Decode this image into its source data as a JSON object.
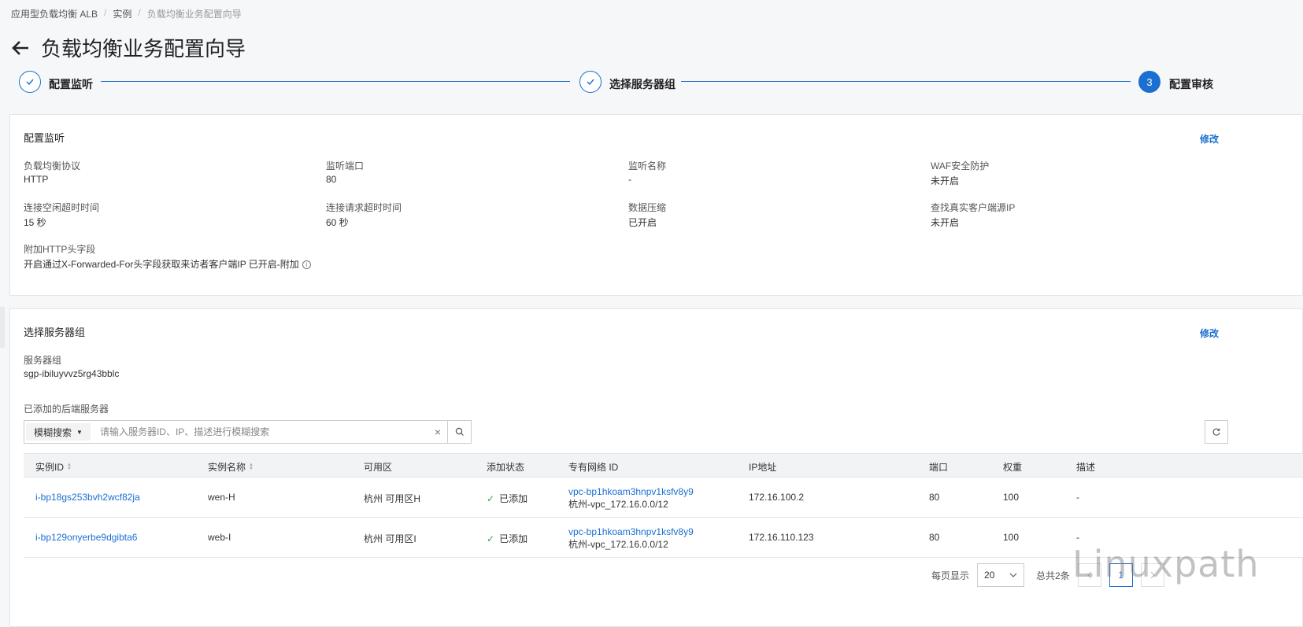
{
  "breadcrumb": [
    "应用型负载均衡 ALB",
    "实例",
    "负载均衡业务配置向导"
  ],
  "page_title": "负载均衡业务配置向导",
  "steps": [
    {
      "label": "配置监听",
      "state": "done"
    },
    {
      "label": "选择服务器组",
      "state": "done"
    },
    {
      "label": "配置审核",
      "state": "current",
      "number": "3"
    }
  ],
  "listen": {
    "title": "配置监听",
    "edit": "修改",
    "fields": [
      {
        "label": "负载均衡协议",
        "value": "HTTP"
      },
      {
        "label": "监听端口",
        "value": "80"
      },
      {
        "label": "监听名称",
        "value": "-"
      },
      {
        "label": "WAF安全防护",
        "value": "未开启"
      },
      {
        "label": "连接空闲超时时间",
        "value": "15 秒"
      },
      {
        "label": "连接请求超时时间",
        "value": "60 秒"
      },
      {
        "label": "数据压缩",
        "value": "已开启"
      },
      {
        "label": "查找真实客户端源IP",
        "value": "未开启"
      },
      {
        "label": "附加HTTP头字段",
        "value": "开启通过X-Forwarded-For头字段获取来访者客户端IP 已开启-附加"
      }
    ],
    "info_icon": "i"
  },
  "server_group": {
    "title": "选择服务器组",
    "edit": "修改",
    "group_label": "服务器组",
    "group_value": "sgp-ibiluyvvz5rg43bblc",
    "added_label": "已添加的后端服务器",
    "search": {
      "type": "模糊搜索",
      "placeholder": "请输入服务器ID、IP、描述进行模糊搜索"
    },
    "columns": [
      "实例ID",
      "实例名称",
      "可用区",
      "添加状态",
      "专有网络 ID",
      "IP地址",
      "端口",
      "权重",
      "描述"
    ],
    "rows": [
      {
        "id": "i-bp18gs253bvh2wcf82ja",
        "name": "wen-H",
        "zone": "杭州 可用区H",
        "status": "已添加",
        "vpc_id": "vpc-bp1hkoam3hnpv1ksfv8y9",
        "vpc_name": "杭州-vpc_172.16.0.0/12",
        "ip": "172.16.100.2",
        "port": "80",
        "weight": "100",
        "desc": "-"
      },
      {
        "id": "i-bp129onyerbe9dgibta6",
        "name": "web-I",
        "zone": "杭州 可用区I",
        "status": "已添加",
        "vpc_id": "vpc-bp1hkoam3hnpv1ksfv8y9",
        "vpc_name": "杭州-vpc_172.16.0.0/12",
        "ip": "172.16.110.123",
        "port": "80",
        "weight": "100",
        "desc": "-"
      }
    ],
    "pager": {
      "per_page_label": "每页显示",
      "per_page": "20",
      "total": "总共2条",
      "current_page": "1"
    }
  },
  "watermark": "Linuxpath",
  "colors": {
    "accent": "#1a6fd0",
    "success": "#3aa346"
  }
}
